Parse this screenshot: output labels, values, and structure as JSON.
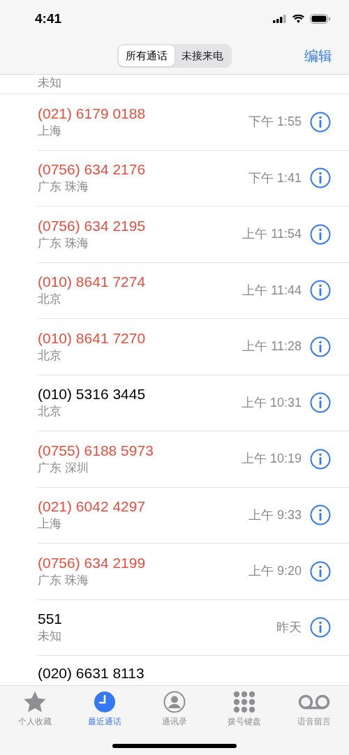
{
  "status_bar": {
    "time": "4:41"
  },
  "nav": {
    "segments": [
      {
        "label": "所有通话",
        "selected": true
      },
      {
        "label": "未接来电",
        "selected": false
      }
    ],
    "edit": "编辑"
  },
  "calls": [
    {
      "kind": "partial",
      "location": "未知"
    },
    {
      "kind": "full",
      "number": "(021) 6179 0188",
      "missed": true,
      "location": "上海",
      "time": "下午 1:55"
    },
    {
      "kind": "full",
      "number": "(0756) 634 2176",
      "missed": true,
      "location": "广东 珠海",
      "time": "下午 1:41"
    },
    {
      "kind": "full",
      "number": "(0756) 634 2195",
      "missed": true,
      "location": "广东 珠海",
      "time": "上午 11:54"
    },
    {
      "kind": "full",
      "number": "(010) 8641 7274",
      "missed": true,
      "location": "北京",
      "time": "上午 11:44"
    },
    {
      "kind": "full",
      "number": "(010) 8641 7270",
      "missed": true,
      "location": "北京",
      "time": "上午 11:28"
    },
    {
      "kind": "full",
      "number": "(010) 5316 3445",
      "missed": false,
      "location": "北京",
      "time": "上午 10:31"
    },
    {
      "kind": "full",
      "number": "(0755) 6188 5973",
      "missed": true,
      "location": "广东 深圳",
      "time": "上午 10:19"
    },
    {
      "kind": "full",
      "number": "(021) 6042 4297",
      "missed": true,
      "location": "上海",
      "time": "上午 9:33"
    },
    {
      "kind": "full",
      "number": "(0756) 634 2199",
      "missed": true,
      "location": "广东 珠海",
      "time": "上午 9:20"
    },
    {
      "kind": "full",
      "number": "551",
      "missed": false,
      "location": "未知",
      "time": "昨天"
    },
    {
      "kind": "cut",
      "number": "(020) 6631 8113",
      "missed": false
    }
  ],
  "tabs": [
    {
      "kind": "star",
      "label": "个人收藏",
      "selected": false
    },
    {
      "kind": "clock",
      "label": "最近通话",
      "selected": true
    },
    {
      "kind": "person",
      "label": "通讯录",
      "selected": false
    },
    {
      "kind": "keypad",
      "label": "拨号键盘",
      "selected": false
    },
    {
      "kind": "voicemail",
      "label": "语音留言",
      "selected": false
    }
  ]
}
